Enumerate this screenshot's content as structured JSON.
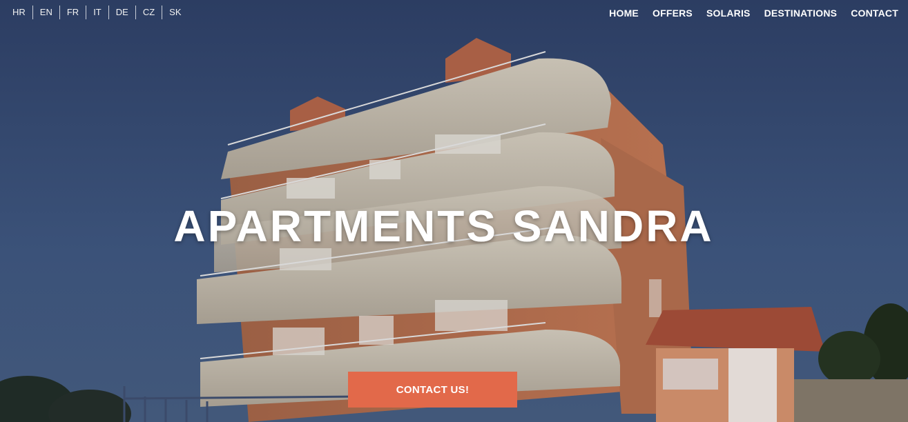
{
  "languages": [
    "HR",
    "EN",
    "FR",
    "IT",
    "DE",
    "CZ",
    "SK"
  ],
  "nav": [
    "HOME",
    "OFFERS",
    "SOLARIS",
    "DESTINATIONS",
    "CONTACT"
  ],
  "hero": {
    "title": "APARTMENTS SANDRA",
    "cta_label": "CONTACT US!"
  },
  "colors": {
    "sky": "#2d3f63",
    "building_facade": "#b9784f",
    "balcony": "#cfc6b6",
    "cta_background": "#e2694a",
    "text": "#ffffff"
  }
}
